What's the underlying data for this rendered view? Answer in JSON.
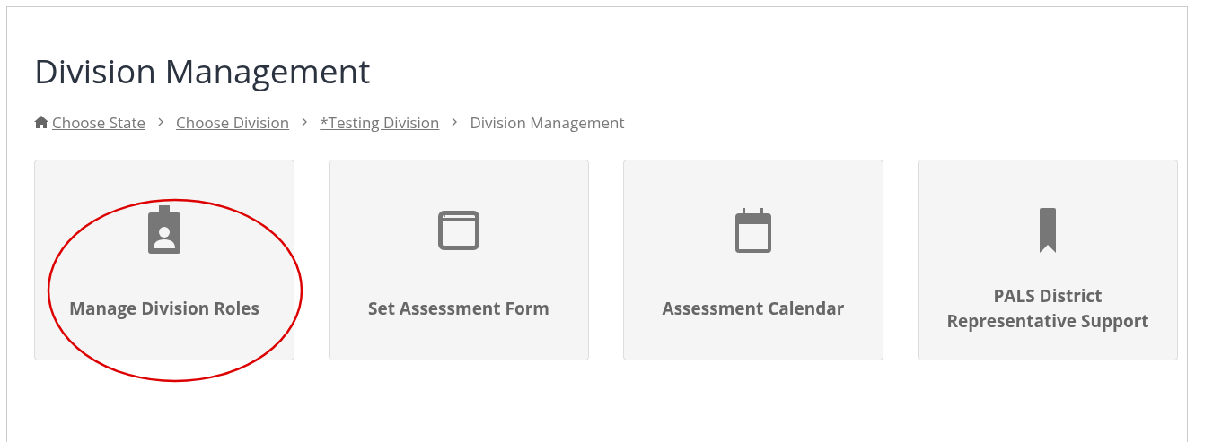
{
  "page": {
    "title": "Division Management"
  },
  "breadcrumb": [
    {
      "label": "Choose State",
      "kind": "link"
    },
    {
      "label": "Choose Division",
      "kind": "link"
    },
    {
      "label": "*Testing Division",
      "kind": "link"
    },
    {
      "label": "Division Management",
      "kind": "current"
    }
  ],
  "cards": [
    {
      "label": "Manage Division Roles",
      "kind": "badge",
      "highlighted": true
    },
    {
      "label": "Set Assessment Form",
      "kind": "window",
      "highlighted": false
    },
    {
      "label": "Assessment Calendar",
      "kind": "calendar",
      "highlighted": false
    },
    {
      "label": "PALS District Representative Support",
      "kind": "bookmark",
      "highlighted": false
    }
  ]
}
